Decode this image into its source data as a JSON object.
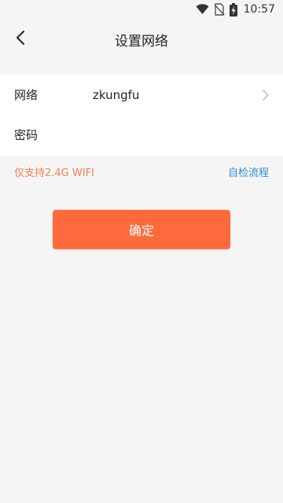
{
  "status_bar": {
    "time": "10:57",
    "icons": [
      "wifi-icon",
      "no-sim-icon",
      "battery-charging-icon"
    ]
  },
  "header": {
    "title": "设置网络",
    "back_icon": "chevron-left-icon"
  },
  "form": {
    "network_label": "网络",
    "network_value": "zkungfu",
    "password_label": "密码",
    "password_value": "",
    "password_placeholder": ""
  },
  "hint": {
    "warning": "仅支持2.4G WIFI",
    "warning_color": "#f07f4f",
    "link": "自检流程",
    "link_color": "#2f8ad6"
  },
  "confirm_button": {
    "label": "确定",
    "color": "#ff6a3d"
  }
}
